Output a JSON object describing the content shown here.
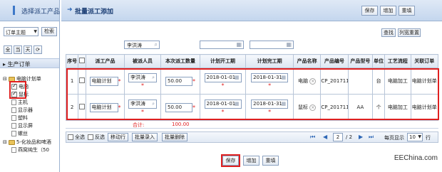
{
  "left_panel": {
    "title": "选择派工产品",
    "order_select": "订单主题",
    "search_label": "检索",
    "mini_buttons": [
      "全",
      "当",
      "天",
      "⟳"
    ],
    "tree_root": "生产订单",
    "tree": {
      "parent": "电脑计划单",
      "items": [
        {
          "label": "电脑",
          "checked": true
        },
        {
          "label": "鼠标",
          "checked": true
        },
        {
          "label": "主机",
          "checked": false
        },
        {
          "label": "显示器",
          "checked": false
        },
        {
          "label": "塑料",
          "checked": false
        },
        {
          "label": "显示屏",
          "checked": false
        },
        {
          "label": "螺丝",
          "checked": false
        }
      ],
      "parent2": "5-化妆品和啤酒",
      "item2": "燕窝纯生（50"
    }
  },
  "main_panel": {
    "title": "批量派工添加",
    "top_buttons": [
      "保存",
      "增加",
      "重填"
    ],
    "filter_value": "李洪涛",
    "tool_buttons": [
      "查找",
      "列宽重置"
    ],
    "columns": [
      "序号",
      "",
      "派工产品",
      "被派人员",
      "本次派工数量",
      "计划开工期",
      "计划完工期",
      "产品名称",
      "产品编号",
      "产品型号",
      "单位",
      "工艺流程",
      "关联订单"
    ],
    "rows": [
      {
        "seq": "1",
        "product": "电脑计划",
        "person": "李洪涛",
        "qty": "50.00",
        "start": "2018-01-01",
        "end": "2018-01-31",
        "name": "电脑",
        "code": "CP_2017112",
        "model": "",
        "unit": "台",
        "process": "电脑加工",
        "order": "电脑计划单"
      },
      {
        "seq": "2",
        "product": "电脑计划",
        "person": "李洪涛",
        "qty": "50.00",
        "start": "2018-01-01",
        "end": "2018-01-31",
        "name": "鼠标",
        "code": "CP_2017112",
        "model": "AA",
        "unit": "个",
        "process": "电脑加工",
        "order": "电脑计划单"
      }
    ],
    "total_label": "合计:",
    "total_value": "100.00",
    "bottom": {
      "select_all": "全选",
      "invert": "反选",
      "move_row": "移动行",
      "batch_input": "批量录入",
      "batch_delete": "批量删除",
      "page_current": "2",
      "page_total": "/ 2",
      "per_page_label": "每页显示",
      "per_page_value": "10",
      "per_page_unit": "行"
    },
    "footer_buttons": [
      "保存",
      "增加",
      "重填"
    ]
  },
  "watermark": "EEChina.com"
}
